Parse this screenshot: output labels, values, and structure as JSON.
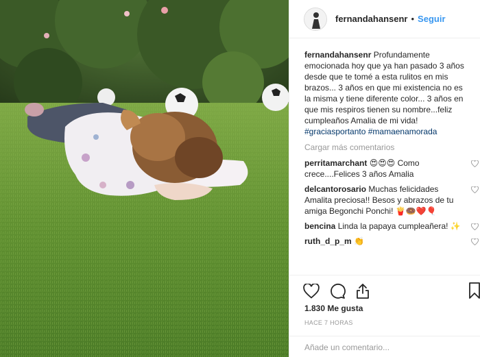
{
  "post": {
    "username": "fernandahansenr",
    "follow_label": "Seguir",
    "dot": "•",
    "caption": {
      "author": "fernandahansenr",
      "text": "Profundamente emocionada hoy que ya han pasado 3 años desde que te tomé a esta rulitos en mis brazos... 3 años en que mi existencia no es la misma y tiene diferente color... 3 años en que mis respiros tienen su nombre...feliz cumpleaños Amalia de mi vida!",
      "hashtags": "#graciasportanto #mamaenamorada"
    },
    "load_more_label": "Cargar más comentarios",
    "comments": [
      {
        "user": "perritamarchant",
        "text": "😍😍😍 Como crece....Felices 3 años Amalia"
      },
      {
        "user": "delcantorosario",
        "text": "Muchas felicidades Amalita preciosa!! Besos y abrazos de tu amiga Begonchi Ponchi! 🍟🍩❤️🎈"
      },
      {
        "user": "bencina",
        "text": "Linda la papaya cumpleañera! ✨"
      },
      {
        "user": "ruth_d_p_m",
        "text": "👏"
      }
    ],
    "likes": "1.830 Me gusta",
    "time": "HACE 7 HORAS",
    "comment_placeholder": "Añade un comentario..."
  },
  "icons": {
    "like": "heart-icon",
    "comment": "comment-bubble-icon",
    "share": "share-icon",
    "save": "bookmark-icon",
    "comment_like": "heart-small-icon"
  },
  "colors": {
    "link": "#3897f0",
    "hashtag": "#003569",
    "muted": "#999999",
    "text": "#262626"
  }
}
